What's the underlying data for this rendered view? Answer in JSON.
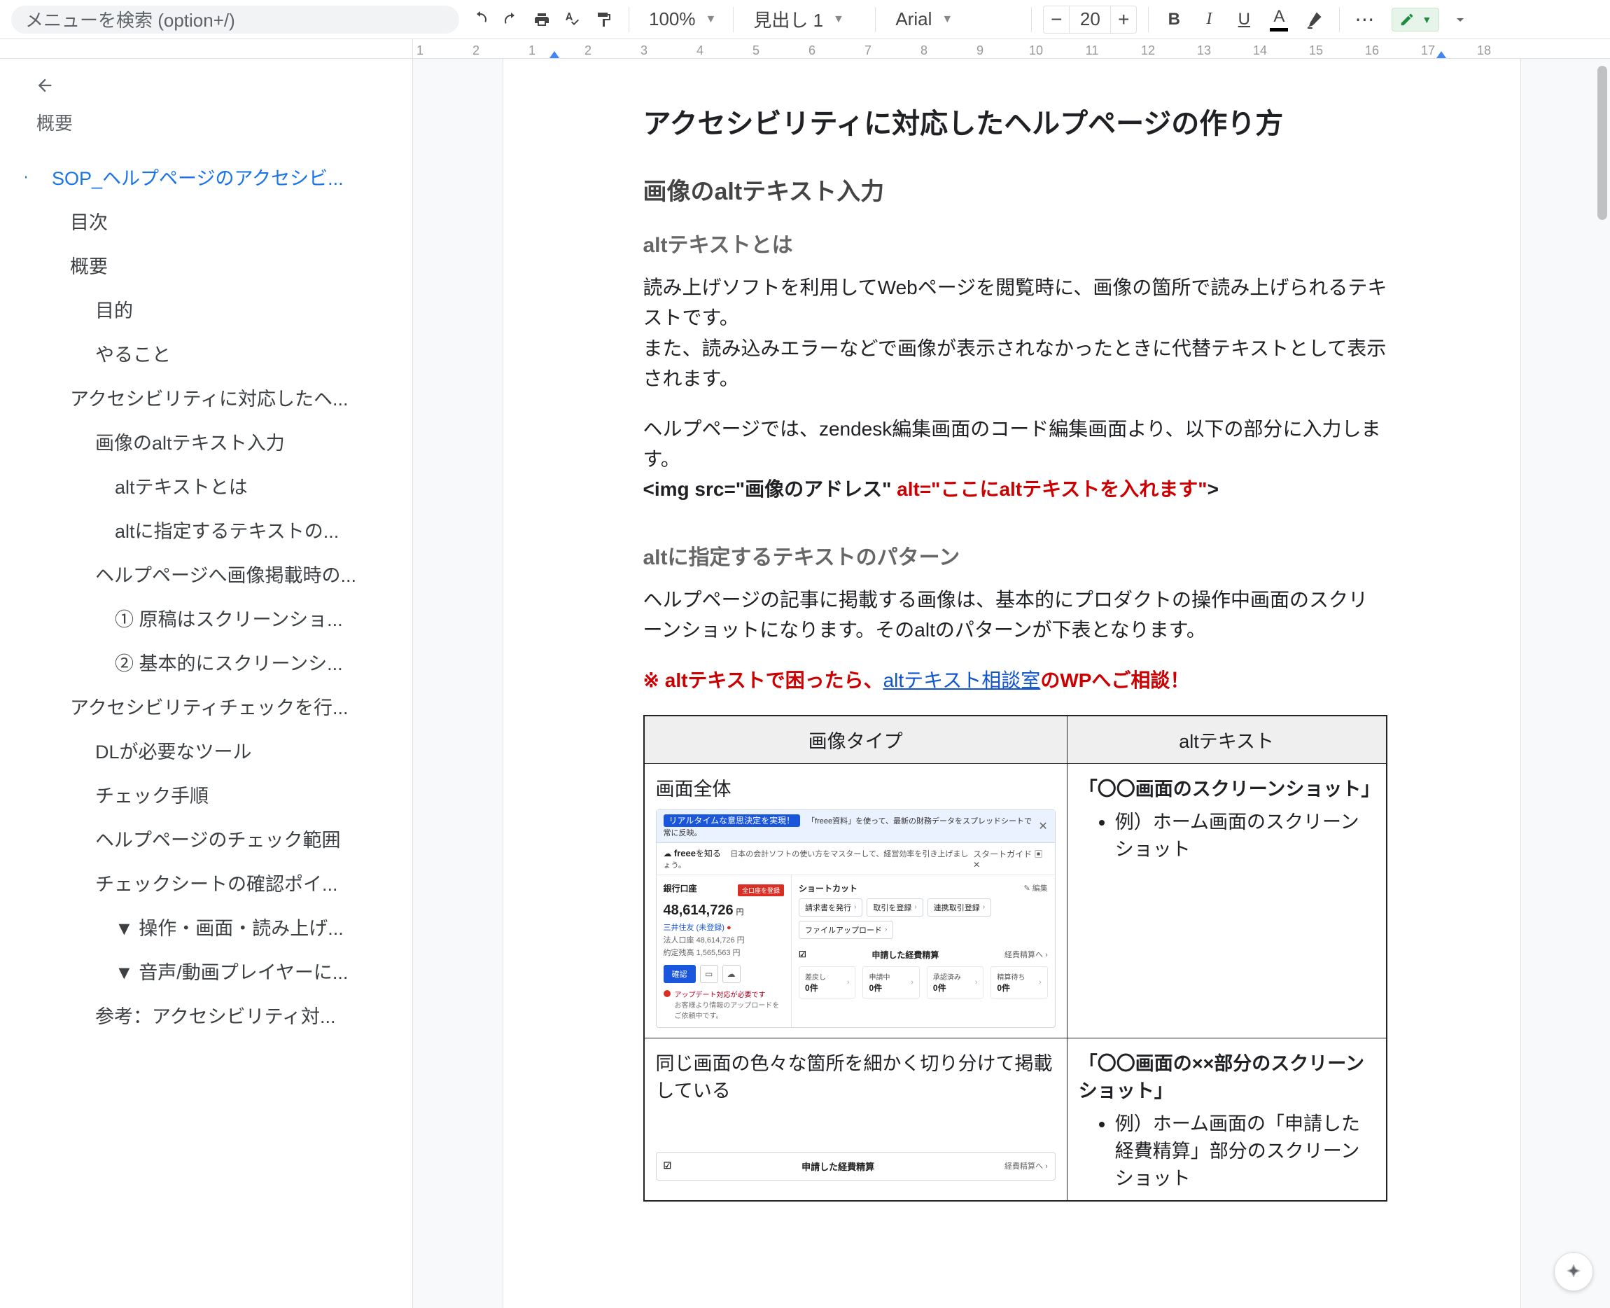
{
  "toolbar": {
    "search_placeholder": "メニューを検索 (option+/)",
    "zoom": "100%",
    "style_select": "見出し 1",
    "font_select": "Arial",
    "font_size": "20",
    "bold": "B",
    "italic": "I",
    "underline": "U",
    "color_letter": "A"
  },
  "ruler": {
    "numbers": [
      "1",
      "2",
      "1",
      "2",
      "3",
      "4",
      "5",
      "6",
      "7",
      "8",
      "9",
      "10",
      "11",
      "12",
      "13",
      "14",
      "15",
      "16",
      "17",
      "18"
    ]
  },
  "outline": {
    "title": "概要",
    "active_text": "SOP_ヘルプページのアクセシビ...",
    "items": [
      {
        "level": 1,
        "text": "目次"
      },
      {
        "level": 1,
        "text": "概要"
      },
      {
        "level": 2,
        "text": "目的"
      },
      {
        "level": 2,
        "text": "やること"
      },
      {
        "level": 1,
        "text": "アクセシビリティに対応したヘ..."
      },
      {
        "level": 2,
        "text": "画像のaltテキスト入力"
      },
      {
        "level": 3,
        "text": "altテキストとは"
      },
      {
        "level": 3,
        "text": "altに指定するテキストの..."
      },
      {
        "level": 2,
        "text": "ヘルプページへ画像掲載時の..."
      },
      {
        "level": 3,
        "text": "① 原稿はスクリーンショ..."
      },
      {
        "level": 3,
        "text": "② 基本的にスクリーンシ..."
      },
      {
        "level": 1,
        "text": "アクセシビリティチェックを行..."
      },
      {
        "level": 2,
        "text": "DLが必要なツール"
      },
      {
        "level": 2,
        "text": "チェック手順"
      },
      {
        "level": 2,
        "text": "ヘルプページのチェック範囲"
      },
      {
        "level": 2,
        "text": "チェックシートの確認ポイ..."
      },
      {
        "level": 3,
        "text": "▼ 操作・画面・読み上げ..."
      },
      {
        "level": 3,
        "text": "▼ 音声/動画プレイヤーに..."
      },
      {
        "level": 2,
        "text": "参考：アクセシビリティ対..."
      }
    ]
  },
  "doc": {
    "h1": "アクセシビリティに対応したヘルプページの作り方",
    "h2_1": "画像のaltテキスト入力",
    "h3_1": "altテキストとは",
    "p1a": "読み上げソフトを利用してWebページを閲覧時に、画像の箇所で読み上げられるテキストです。",
    "p1b": "また、読み込みエラーなどで画像が表示されなかったときに代替テキストとして表示されます。",
    "p2": "ヘルプページでは、zendesk編集画面のコード編集画面より、以下の部分に入力します。",
    "code_prefix": "<img src=\"画像のアドレス\" ",
    "code_red": "alt=\"ここにaltテキストを入れます\"",
    "code_suffix": ">",
    "h3_2": "altに指定するテキストのパターン",
    "p3": "ヘルプページの記事に掲載する画像は、基本的にプロダクトの操作中画面のスクリーンショットになります。そのaltのパターンが下表となります。",
    "warn_prefix": "※ altテキストで困ったら、",
    "warn_link": "altテキスト相談室",
    "warn_suffix": "のWPへご相談！",
    "table": {
      "th1": "画像タイプ",
      "th2": "altテキスト",
      "r1_left": "画面全体",
      "r1_right_head": "「〇〇画面のスクリーンショット」",
      "r1_right_li": "例）ホーム画面のスクリーンショット",
      "r2_left": "同じ画面の色々な箇所を細かく切り分けて掲載している",
      "r2_right_head": "「〇〇画面の××部分のスクリーンショット」",
      "r2_right_li": "例）ホーム画面の「申請した経費精算」部分のスクリーンショット"
    }
  },
  "mock": {
    "banner_badge": "リアルタイムな意思決定を実現！",
    "banner_text": "「freee資料」を使って、最新の財務データをスプレッドシートで常に反映。",
    "sub_logo_prefix": "☁ ",
    "sub_logo_bold": "freee",
    "sub_logo_suffix": "を知る",
    "sub_text": "日本の会計ソフトの使い方をマスターして、経営効率を引き上げましょう。",
    "sub_right_label": "スタートガイド",
    "sub_right_icons": "▣ ✕",
    "left_label": "銀行口座",
    "left_btn": "全口座を登録",
    "left_amount": "48,614,726",
    "left_yen": "円",
    "left_sub1": "三井住友 (未登録)",
    "left_sub1_badge": "●",
    "left_sub2a": "法人口座",
    "left_sub2a_val": "48,614,726 円",
    "left_sub2b": "約定残高",
    "left_sub2b_val": "1,565,563 円",
    "left_prim": "確認",
    "left_warn_title": "アップデート対応が必要です",
    "left_warn_body": "お客様より情報のアップロードをご依頼中です。",
    "sc_title": "ショートカット",
    "sc_edit": "✎ 編集",
    "chips": [
      "請求書を発行",
      "取引を登録",
      "連携取引登録",
      "ファイルアップロード"
    ],
    "sec2_title": "申請した経費精算",
    "sec2_link": "経費精算へ ›",
    "stats": [
      {
        "k": "差戻し",
        "v": "0件"
      },
      {
        "k": "申請中",
        "v": "0件"
      },
      {
        "k": "承認済み",
        "v": "0件"
      },
      {
        "k": "精算待ち",
        "v": "0件"
      }
    ]
  }
}
